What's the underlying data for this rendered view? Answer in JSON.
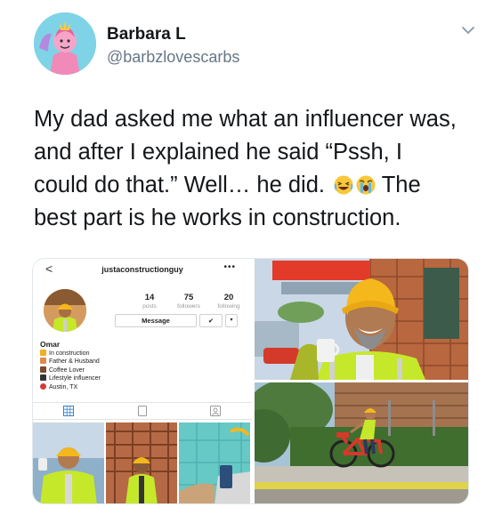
{
  "tweet": {
    "display_name": "Barbara L",
    "handle": "@barbzlovescarbs",
    "text_before_emoji": "My dad asked me what an influencer was, and after I explained he said “Pssh, I could do that.” Well… he did.",
    "text_after_emoji": "The best part is he works in construction.",
    "emojis": [
      "laughing-emoji",
      "crying-emoji"
    ]
  },
  "instagram": {
    "back": "<",
    "username": "justaconstructionguy",
    "more": "•••",
    "stats": [
      {
        "num": "14",
        "label": "posts"
      },
      {
        "num": "75",
        "label": "followers"
      },
      {
        "num": "20",
        "label": "following"
      }
    ],
    "message_label": "Message",
    "follow_label": "✔",
    "dropdown_label": "▾",
    "name": "Omar",
    "bio": [
      {
        "icon": "hardhat-icon",
        "color": "#f2b01e",
        "text": "In construction"
      },
      {
        "icon": "family-icon",
        "color": "#e08a4c",
        "text": "Father & Husband"
      },
      {
        "icon": "coffee-icon",
        "color": "#7a4a2a",
        "text": "Coffee Lover"
      },
      {
        "icon": "phone-icon",
        "color": "#333333",
        "text": "Lifestyle influencer"
      },
      {
        "icon": "pin-icon",
        "color": "#d63b3b",
        "text": "Austin, TX"
      }
    ]
  },
  "colors": {
    "text": "#14171a",
    "muted": "#657786",
    "safety_vest": "#c6e82a",
    "hard_hat": "#f4b81c"
  }
}
